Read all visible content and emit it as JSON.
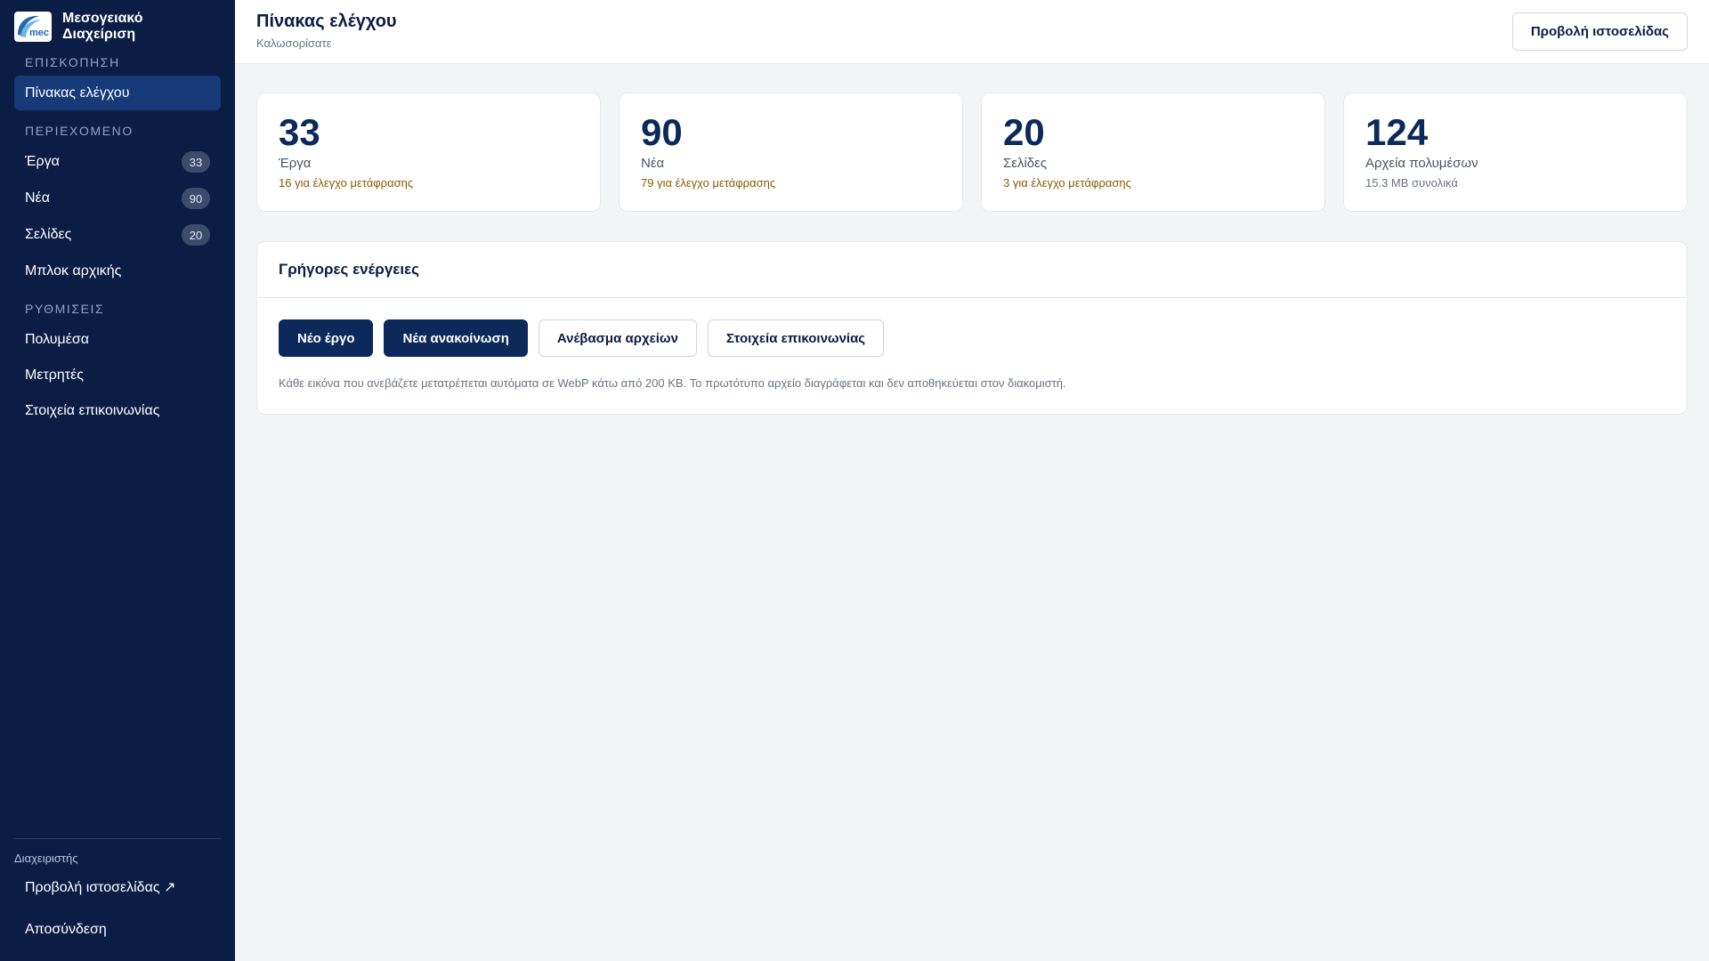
{
  "brand": {
    "name_line1": "Μεσογειακό",
    "name_line2": "Διαχείριση",
    "logo_text": "mec"
  },
  "sidebar": {
    "sections": [
      {
        "label": "ΕΠΙΣΚΟΠΗΣΗ"
      },
      {
        "label": "ΠΕΡΙΕΧΟΜΕΝΟ"
      },
      {
        "label": "ΡΥΘΜΙΣΕΙΣ"
      }
    ],
    "items": [
      {
        "label": "Πίνακας ελέγχου",
        "active": true
      },
      {
        "label": "Έργα",
        "count": "33"
      },
      {
        "label": "Νέα",
        "count": "90"
      },
      {
        "label": "Σελίδες",
        "count": "20"
      },
      {
        "label": "Μπλοκ αρχικής"
      },
      {
        "label": "Πολυμέσα"
      },
      {
        "label": "Μετρητές"
      },
      {
        "label": "Στοιχεία επικοινωνίας"
      }
    ],
    "user_role": "Διαχειριστής",
    "view_site": "Προβολή ιστοσελίδας ↗",
    "logout": "Αποσύνδεση"
  },
  "header": {
    "title": "Πίνακας ελέγχου",
    "subtitle": "Καλωσορίσατε",
    "view_site_button": "Προβολή ιστοσελίδας"
  },
  "stats": [
    {
      "value": "33",
      "label": "Έργα",
      "note": "16 για έλεγχο μετάφρασης",
      "note_type": "warning"
    },
    {
      "value": "90",
      "label": "Νέα",
      "note": "79 για έλεγχο μετάφρασης",
      "note_type": "warning"
    },
    {
      "value": "20",
      "label": "Σελίδες",
      "note": "3 για έλεγχο μετάφρασης",
      "note_type": "warning"
    },
    {
      "value": "124",
      "label": "Αρχεία πολυμέσων",
      "note": "15.3 MB συνολικά",
      "note_type": "muted"
    }
  ],
  "quick_actions": {
    "title": "Γρήγορες ενέργειες",
    "buttons": [
      {
        "label": "Νέο έργο",
        "style": "primary"
      },
      {
        "label": "Νέα ανακοίνωση",
        "style": "primary"
      },
      {
        "label": "Ανέβασμα αρχείων",
        "style": "outline"
      },
      {
        "label": "Στοιχεία επικοινωνίας",
        "style": "outline"
      }
    ],
    "note": "Κάθε εικόνα που ανεβάζετε μετατρέπεται αυτόματα σε WebP κάτω από 200 KB. Το πρωτότυπο αρχείο διαγράφεται και δεν αποθηκεύεται στον διακομιστή."
  },
  "colors": {
    "sidebar_bg": "#0b1d45",
    "sidebar_active": "#163a78",
    "primary": "#0b2a5b",
    "warning_text": "#8a5a00",
    "page_bg": "#f3f4f6"
  }
}
